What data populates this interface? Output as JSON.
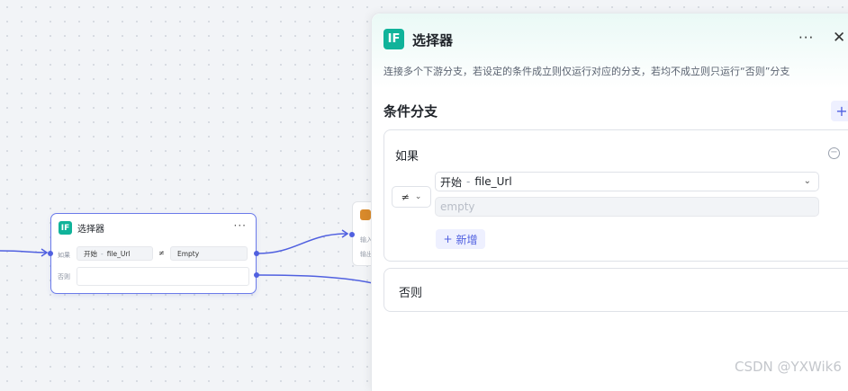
{
  "canvas": {
    "node": {
      "icon": "IF",
      "title": "选择器",
      "more": "···",
      "if_label": "如果",
      "else_label": "否则",
      "condition": {
        "var_source": "开始",
        "var_name": "file_Url",
        "operator": "≠",
        "value": "Empty"
      }
    },
    "next_node": {
      "line1": "输入",
      "line2": "输出"
    }
  },
  "panel": {
    "icon": "IF",
    "title": "选择器",
    "more": "···",
    "close": "✕",
    "description": "连接多个下游分支，若设定的条件成立则仅运行对应的分支，若均不成立则只运行“否则”分支",
    "section_title": "条件分支",
    "add_branch": "+",
    "if_card": {
      "label": "如果",
      "remove": "−",
      "operator": "≠",
      "variable_source": "开始",
      "variable_name": "file_Url",
      "value_placeholder": "empty",
      "add_condition": "新增",
      "add_icon": "+"
    },
    "else_card": {
      "label": "否则"
    }
  },
  "watermark": "CSDN @YXWik6",
  "colors": {
    "accent": "#5060e0",
    "if_badge": "#10b39a"
  }
}
